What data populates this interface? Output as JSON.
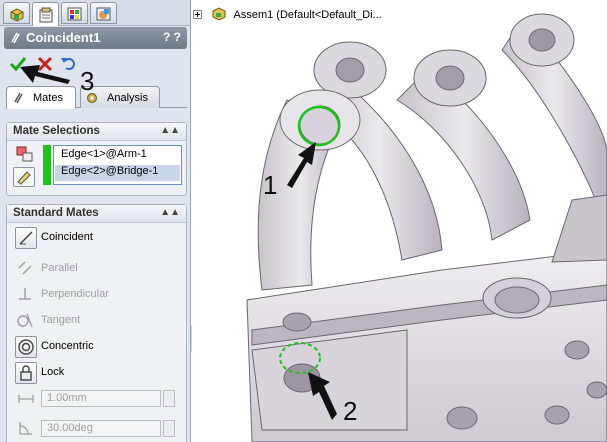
{
  "feature": {
    "title": "Coincident1",
    "help": "? ?"
  },
  "tabs": {
    "mates": "Mates",
    "analysis": "Analysis"
  },
  "mate_selections": {
    "header": "Mate Selections",
    "items": [
      "Edge<1>@Arm-1",
      "Edge<2>@Bridge-1"
    ]
  },
  "standard_mates": {
    "header": "Standard Mates",
    "coincident": "Coincident",
    "parallel": "Parallel",
    "perpendicular": "Perpendicular",
    "tangent": "Tangent",
    "concentric": "Concentric",
    "lock": "Lock",
    "distance_value": "1.00mm",
    "angle_value": "30.00deg"
  },
  "tree": {
    "assembly": "Assem1  (Default<Default_Di..."
  },
  "callouts": {
    "one": "1",
    "two": "2",
    "three": "3"
  },
  "colors": {
    "accept_green": "#1aa51a",
    "cancel_red": "#d01c1c",
    "selection_green": "#1ec31e"
  },
  "icons": [
    "feature-manager-icon",
    "property-manager-icon",
    "configuration-manager-icon",
    "display-manager-icon",
    "mate-clip-icon",
    "check-icon",
    "close-icon",
    "undo-icon",
    "coincident-icon",
    "parallel-icon",
    "perpendicular-icon",
    "tangent-icon",
    "concentric-icon",
    "lock-icon",
    "distance-icon",
    "angle-icon",
    "assembly-icon"
  ]
}
